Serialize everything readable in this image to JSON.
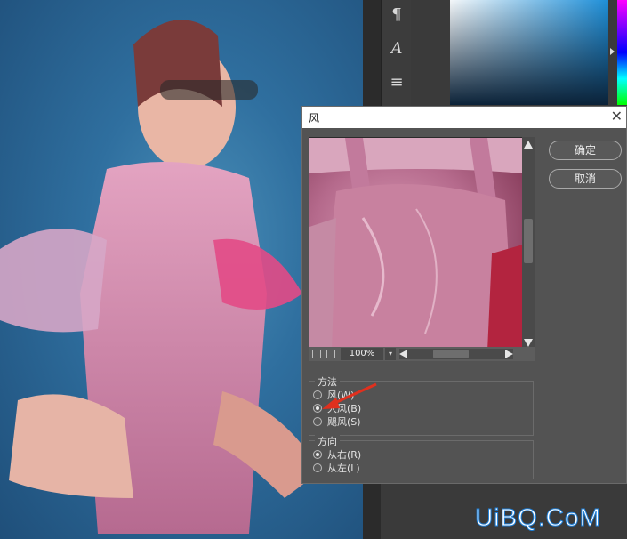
{
  "toolstrip": {
    "icons": [
      "paragraph-icon",
      "character-icon",
      "adjustments-icon"
    ],
    "glyphs": [
      "¶",
      "A",
      "≡"
    ]
  },
  "dialog": {
    "title": "风",
    "close_glyph": "✕",
    "ok_label": "确定",
    "cancel_label": "取消",
    "zoom": "100%",
    "method": {
      "legend": "方法",
      "options": [
        "风(W)",
        "大风(B)",
        "飓风(S)"
      ],
      "selected": 1
    },
    "direction": {
      "legend": "方向",
      "options": [
        "从右(R)",
        "从左(L)"
      ],
      "selected": 0
    }
  },
  "watermark": "UiBQ.CoM",
  "colors": {
    "arrow": "#e0301e",
    "panel": "#535353",
    "watermark_outline": "#1e7fd8"
  }
}
